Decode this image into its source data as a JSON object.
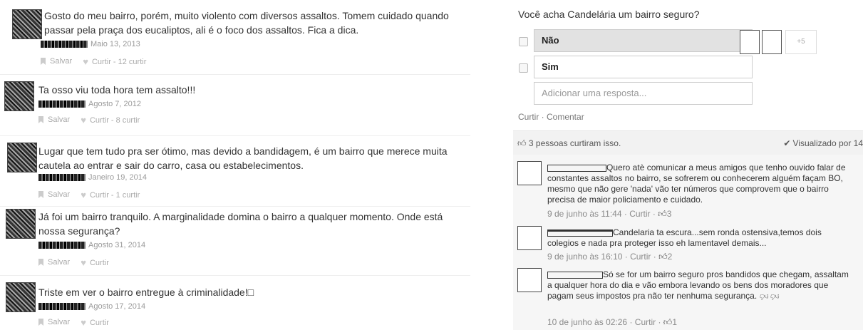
{
  "reviews": [
    {
      "text": "Gosto do meu bairro, porém, muito violento com diversos assaltos. Tomem cuidado quando passar pela praça dos eucaliptos, ali é o foco dos assaltos. Fica a dica.",
      "date": "Maio 13, 2013",
      "save": "Salvar",
      "like": "Curtir - 12 curtir"
    },
    {
      "text": "Ta osso viu toda hora tem assalto!!!",
      "date": "Agosto 7, 2012",
      "save": "Salvar",
      "like": "Curtir - 8 curtir"
    },
    {
      "text": "Lugar que tem tudo pra ser ótimo, mas devido a bandidagem, é um bairro que merece muita cautela ao entrar e sair do carro, casa ou estabelecimentos.",
      "date": "Janeiro 19, 2014",
      "save": "Salvar",
      "like": "Curtir - 1 curtir"
    },
    {
      "text": "Já foi um bairro tranquilo. A marginalidade domina o bairro a qualquer momento. Onde está nossa segurança?",
      "date": "Agosto 31, 2014",
      "save": "Salvar",
      "like": "Curtir"
    },
    {
      "text": "Triste em ver o bairro entregue à criminalidade!□",
      "date": "Agosto 17, 2014",
      "save": "Salvar",
      "like": "Curtir"
    }
  ],
  "poll": {
    "question": "Você acha Candelária um bairro seguro?",
    "options": [
      {
        "label": "Não",
        "selected": true
      },
      {
        "label": "Sim",
        "selected": false
      }
    ],
    "add_placeholder": "Adicionar uma resposta...",
    "more_voters": "+5"
  },
  "fb_actions": "Curtir · Comentar",
  "likes_summary": "3 pessoas curtiram isso.",
  "seen_by": "Visualizado por 14",
  "comments": [
    {
      "text": "Quero atè comunicar a meus amigos que tenho ouvido falar de constantes assaltos no bairro, se sofrerem ou conhecerem alguém façam BO, mesmo que não gere 'nada' vão ter números que comprovem que o bairro precisa de maior policiamento e cuidado.",
      "time": "9 de junho às 11:44",
      "action": "Curtir",
      "likes": "3"
    },
    {
      "text": "Candelaria ta escura...sem ronda ostensiva,temos dois colegios e nada pra proteger isso eh lamentavel demais...",
      "time": "9 de junho às 16:10",
      "action": "Curtir",
      "likes": "2"
    },
    {
      "text": "Só se for um bairro seguro pros bandidos que chegam, assaltam a qualquer hora do dia e vão embora levando os bens dos moradores que pagam seus impostos pra não ter nenhuma segurança.",
      "time": "10 de junho às 02:26",
      "action": "Curtir",
      "likes": "1"
    }
  ],
  "icons": {
    "bookmark": "bookmark-icon",
    "heart": "heart-icon",
    "thumbs_up": "thumbs-up-icon",
    "thumbs_down": "thumbs-down-icon",
    "check": "check-icon"
  }
}
